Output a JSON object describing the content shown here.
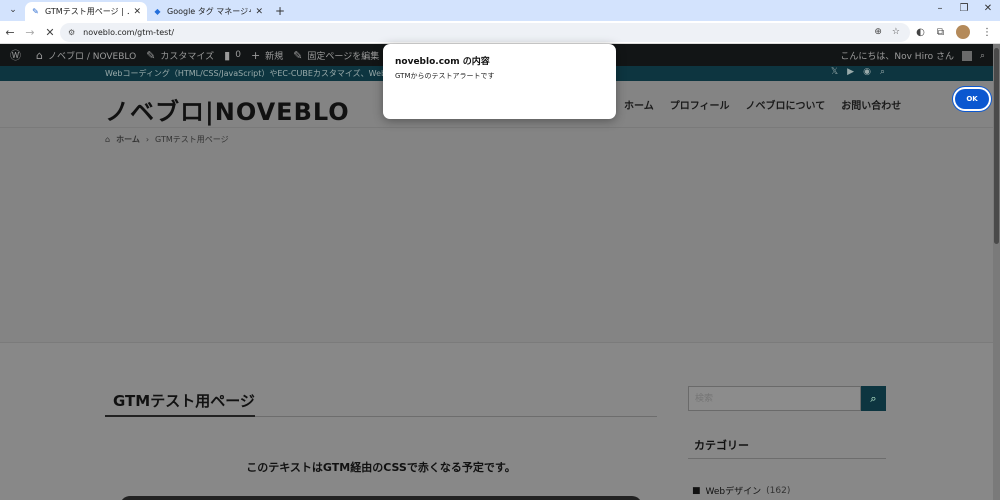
{
  "browser": {
    "tabs": [
      {
        "title": "GTMテスト用ページ | ノベブロ / NOV",
        "active": true,
        "favicon": "noveblo-icon"
      },
      {
        "title": "Google タグ マネージャー",
        "active": false,
        "favicon": "gtm-icon"
      }
    ],
    "new_tab": "+",
    "tab_close": "✕",
    "url": "noveblo.com/gtm-test/",
    "window": {
      "minimize": "–",
      "maximize": "❐",
      "close": "✕"
    }
  },
  "wp_admin_bar": {
    "site_name": "ノベブロ / NOVEBLO",
    "customize": "カスタマイズ",
    "comments_count": "0",
    "new": "新規",
    "edit_page": "固定ページを編集",
    "greeting": "こんにちは、Nov Hiro さん"
  },
  "subbar": {
    "tagline": "Webコーディング（HTML/CSS/JavaScript）やEC-CUBEカスタマイズ、Web..."
  },
  "header": {
    "logo": "ノベブロ|NOVEBLO",
    "nav": [
      "ホーム",
      "プロフィール",
      "ノベブロについて",
      "お問い合わせ"
    ]
  },
  "breadcrumb": {
    "home": "ホーム",
    "current": "GTMテスト用ページ"
  },
  "post": {
    "title": "GTMテスト用ページ",
    "text": "このテキストはGTM経由のCSSで赤くなる予定です。"
  },
  "sidebar": {
    "search_placeholder": "検索",
    "categories_title": "カテゴリー",
    "categories": [
      {
        "name": "Webデザイン",
        "count": "(162)"
      }
    ]
  },
  "dialog": {
    "title": "noveblo.com の内容",
    "message": "GTMからのテストアラートです",
    "ok_label": "OK"
  },
  "colors": {
    "accent": "#0b57d0",
    "header_dark": "#0d3540",
    "overlay_page": "#888888"
  }
}
